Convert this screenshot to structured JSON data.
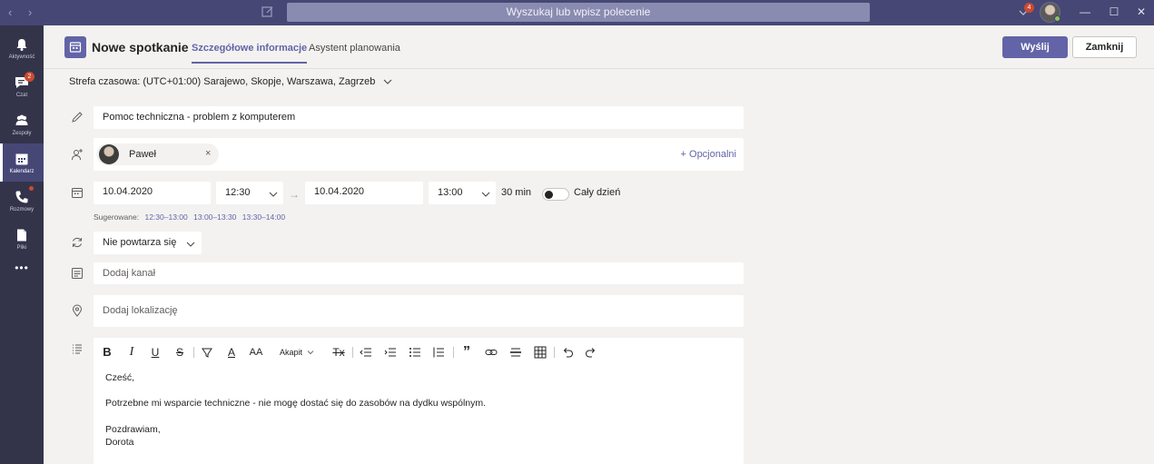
{
  "titlebar": {
    "search_placeholder": "Wyszukaj lub wpisz polecenie",
    "notification_count": "4"
  },
  "rail": {
    "items": [
      {
        "label": "Aktywność",
        "icon": "bell-icon"
      },
      {
        "label": "Czat",
        "icon": "chat-icon",
        "badge": "2"
      },
      {
        "label": "Zespoły",
        "icon": "teams-icon"
      },
      {
        "label": "Kalendarz",
        "icon": "calendar-icon"
      },
      {
        "label": "Rozmowy",
        "icon": "phone-icon"
      },
      {
        "label": "Pliki",
        "icon": "file-icon"
      }
    ],
    "more": "•••"
  },
  "header": {
    "title": "Nowe spotkanie",
    "tabs": [
      {
        "label": "Szczegółowe informacje",
        "active": true
      },
      {
        "label": "Asystent planowania",
        "active": false
      }
    ],
    "send_label": "Wyślij",
    "close_label": "Zamknij"
  },
  "timezone": "Strefa czasowa: (UTC+01:00) Sarajewo, Skopje, Warszawa, Zagrzeb",
  "form": {
    "title_value": "Pomoc techniczna - problem z komputerem",
    "attendee": {
      "name": "Paweł",
      "remove": "×"
    },
    "optional_link": "+ Opcjonalni",
    "start_date": "10.04.2020",
    "start_time": "12:30",
    "end_date": "10.04.2020",
    "end_time": "13:00",
    "arrow": "→",
    "duration": "30 min",
    "all_day_label": "Cały dzień",
    "suggested_label": "Sugerowane:",
    "suggested_slots": [
      "12:30–13:00",
      "13:00–13:30",
      "13:30–14:00"
    ],
    "repeat": "Nie powtarza się",
    "channel_placeholder": "Dodaj kanał",
    "location_placeholder": "Dodaj lokalizację"
  },
  "editor": {
    "toolbar": {
      "bold": "B",
      "italic": "I",
      "underline": "U",
      "strike": "S",
      "font_color": "A",
      "font_size": "AA",
      "paragraph": "Akapit",
      "clear_format": "Tx",
      "quote": "”"
    },
    "lines": [
      "Cześć,",
      "Potrzebne mi wsparcie techniczne - nie mogę dostać się do zasobów na dydku wspólnym.",
      "Pozdrawiam,",
      "Dorota"
    ]
  },
  "colors": {
    "titlebar": "#464775",
    "rail": "#33344a",
    "accent": "#6264a7",
    "badge": "#cc4a31"
  }
}
